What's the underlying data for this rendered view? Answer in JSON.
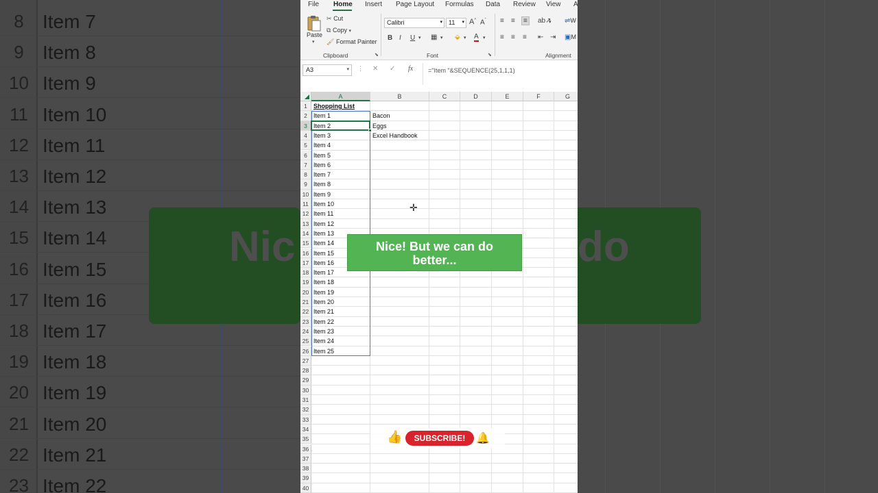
{
  "background": {
    "rows": [
      {
        "n": "8",
        "t": "Item 7"
      },
      {
        "n": "9",
        "t": "Item 8"
      },
      {
        "n": "10",
        "t": "Item 9"
      },
      {
        "n": "11",
        "t": "Item 10"
      },
      {
        "n": "12",
        "t": "Item 11"
      },
      {
        "n": "13",
        "t": "Item 12"
      },
      {
        "n": "14",
        "t": "Item 13"
      },
      {
        "n": "15",
        "t": "Item 14"
      },
      {
        "n": "16",
        "t": "Item 15"
      },
      {
        "n": "17",
        "t": "Item 16"
      },
      {
        "n": "18",
        "t": "Item 17"
      },
      {
        "n": "19",
        "t": "Item 18"
      },
      {
        "n": "20",
        "t": "Item 19"
      },
      {
        "n": "21",
        "t": "Item 20"
      },
      {
        "n": "22",
        "t": "Item 21"
      },
      {
        "n": "23",
        "t": "Item 22"
      }
    ],
    "band_left_text": "Nic",
    "band_right_text": "do"
  },
  "menu": {
    "tabs": [
      "File",
      "Home",
      "Insert",
      "Page Layout",
      "Formulas",
      "Data",
      "Review",
      "View",
      "A"
    ],
    "active": "Home"
  },
  "ribbon": {
    "paste_label": "Paste",
    "cut_label": "Cut",
    "copy_label": "Copy",
    "format_painter_label": "Format Painter",
    "clipboard_group": "Clipboard",
    "font_name": "Calibri",
    "font_size": "11",
    "font_group": "Font",
    "alignment_group": "Alignment",
    "bold": "B",
    "italic": "I",
    "underline": "U",
    "grow_font": "A",
    "shrink_font": "A",
    "font_color": "A",
    "wrap_partial": "W",
    "merge_partial": "M"
  },
  "formula_bar": {
    "name_box": "A3",
    "formula": "=\"Item \"&SEQUENCE(25,1,1,1)",
    "fx": "fx"
  },
  "grid": {
    "columns": [
      "A",
      "B",
      "C",
      "D",
      "E",
      "F",
      "G"
    ],
    "row_numbers": [
      "1",
      "2",
      "3",
      "4",
      "5",
      "6",
      "7",
      "8",
      "9",
      "10",
      "11",
      "12",
      "13",
      "14",
      "15",
      "16",
      "17",
      "18",
      "19",
      "20",
      "21",
      "22",
      "23",
      "24",
      "25",
      "26",
      "27",
      "28",
      "29",
      "30",
      "31",
      "32",
      "33",
      "34",
      "35",
      "36",
      "37",
      "38",
      "39",
      "40"
    ],
    "col_a": [
      "Shopping List",
      "Item 1",
      "Item 2",
      "Item 3",
      "Item 4",
      "Item 5",
      "Item 6",
      "Item 7",
      "Item 8",
      "Item 9",
      "Item 10",
      "Item 11",
      "Item 12",
      "Item 13",
      "Item 14",
      "Item 15",
      "Item 16",
      "Item 17",
      "Item 18",
      "Item 19",
      "Item 20",
      "Item 21",
      "Item 22",
      "Item 23",
      "Item 24",
      "Item 25"
    ],
    "col_b": [
      "",
      "Bacon",
      "Eggs",
      "Excel Handbook"
    ],
    "selected_cell": "A3"
  },
  "overlay": {
    "banner_line1": "Nice! But we can do",
    "banner_line2": "better...",
    "subscribe_label": "SUBSCRIBE!",
    "like_icon": "thumbs-up-icon",
    "bell_icon": "bell-icon"
  },
  "colors": {
    "excel_green": "#217346",
    "banner_green": "#53b454",
    "subscribe_red": "#d8232a",
    "spill_blue": "#4a78c8"
  }
}
